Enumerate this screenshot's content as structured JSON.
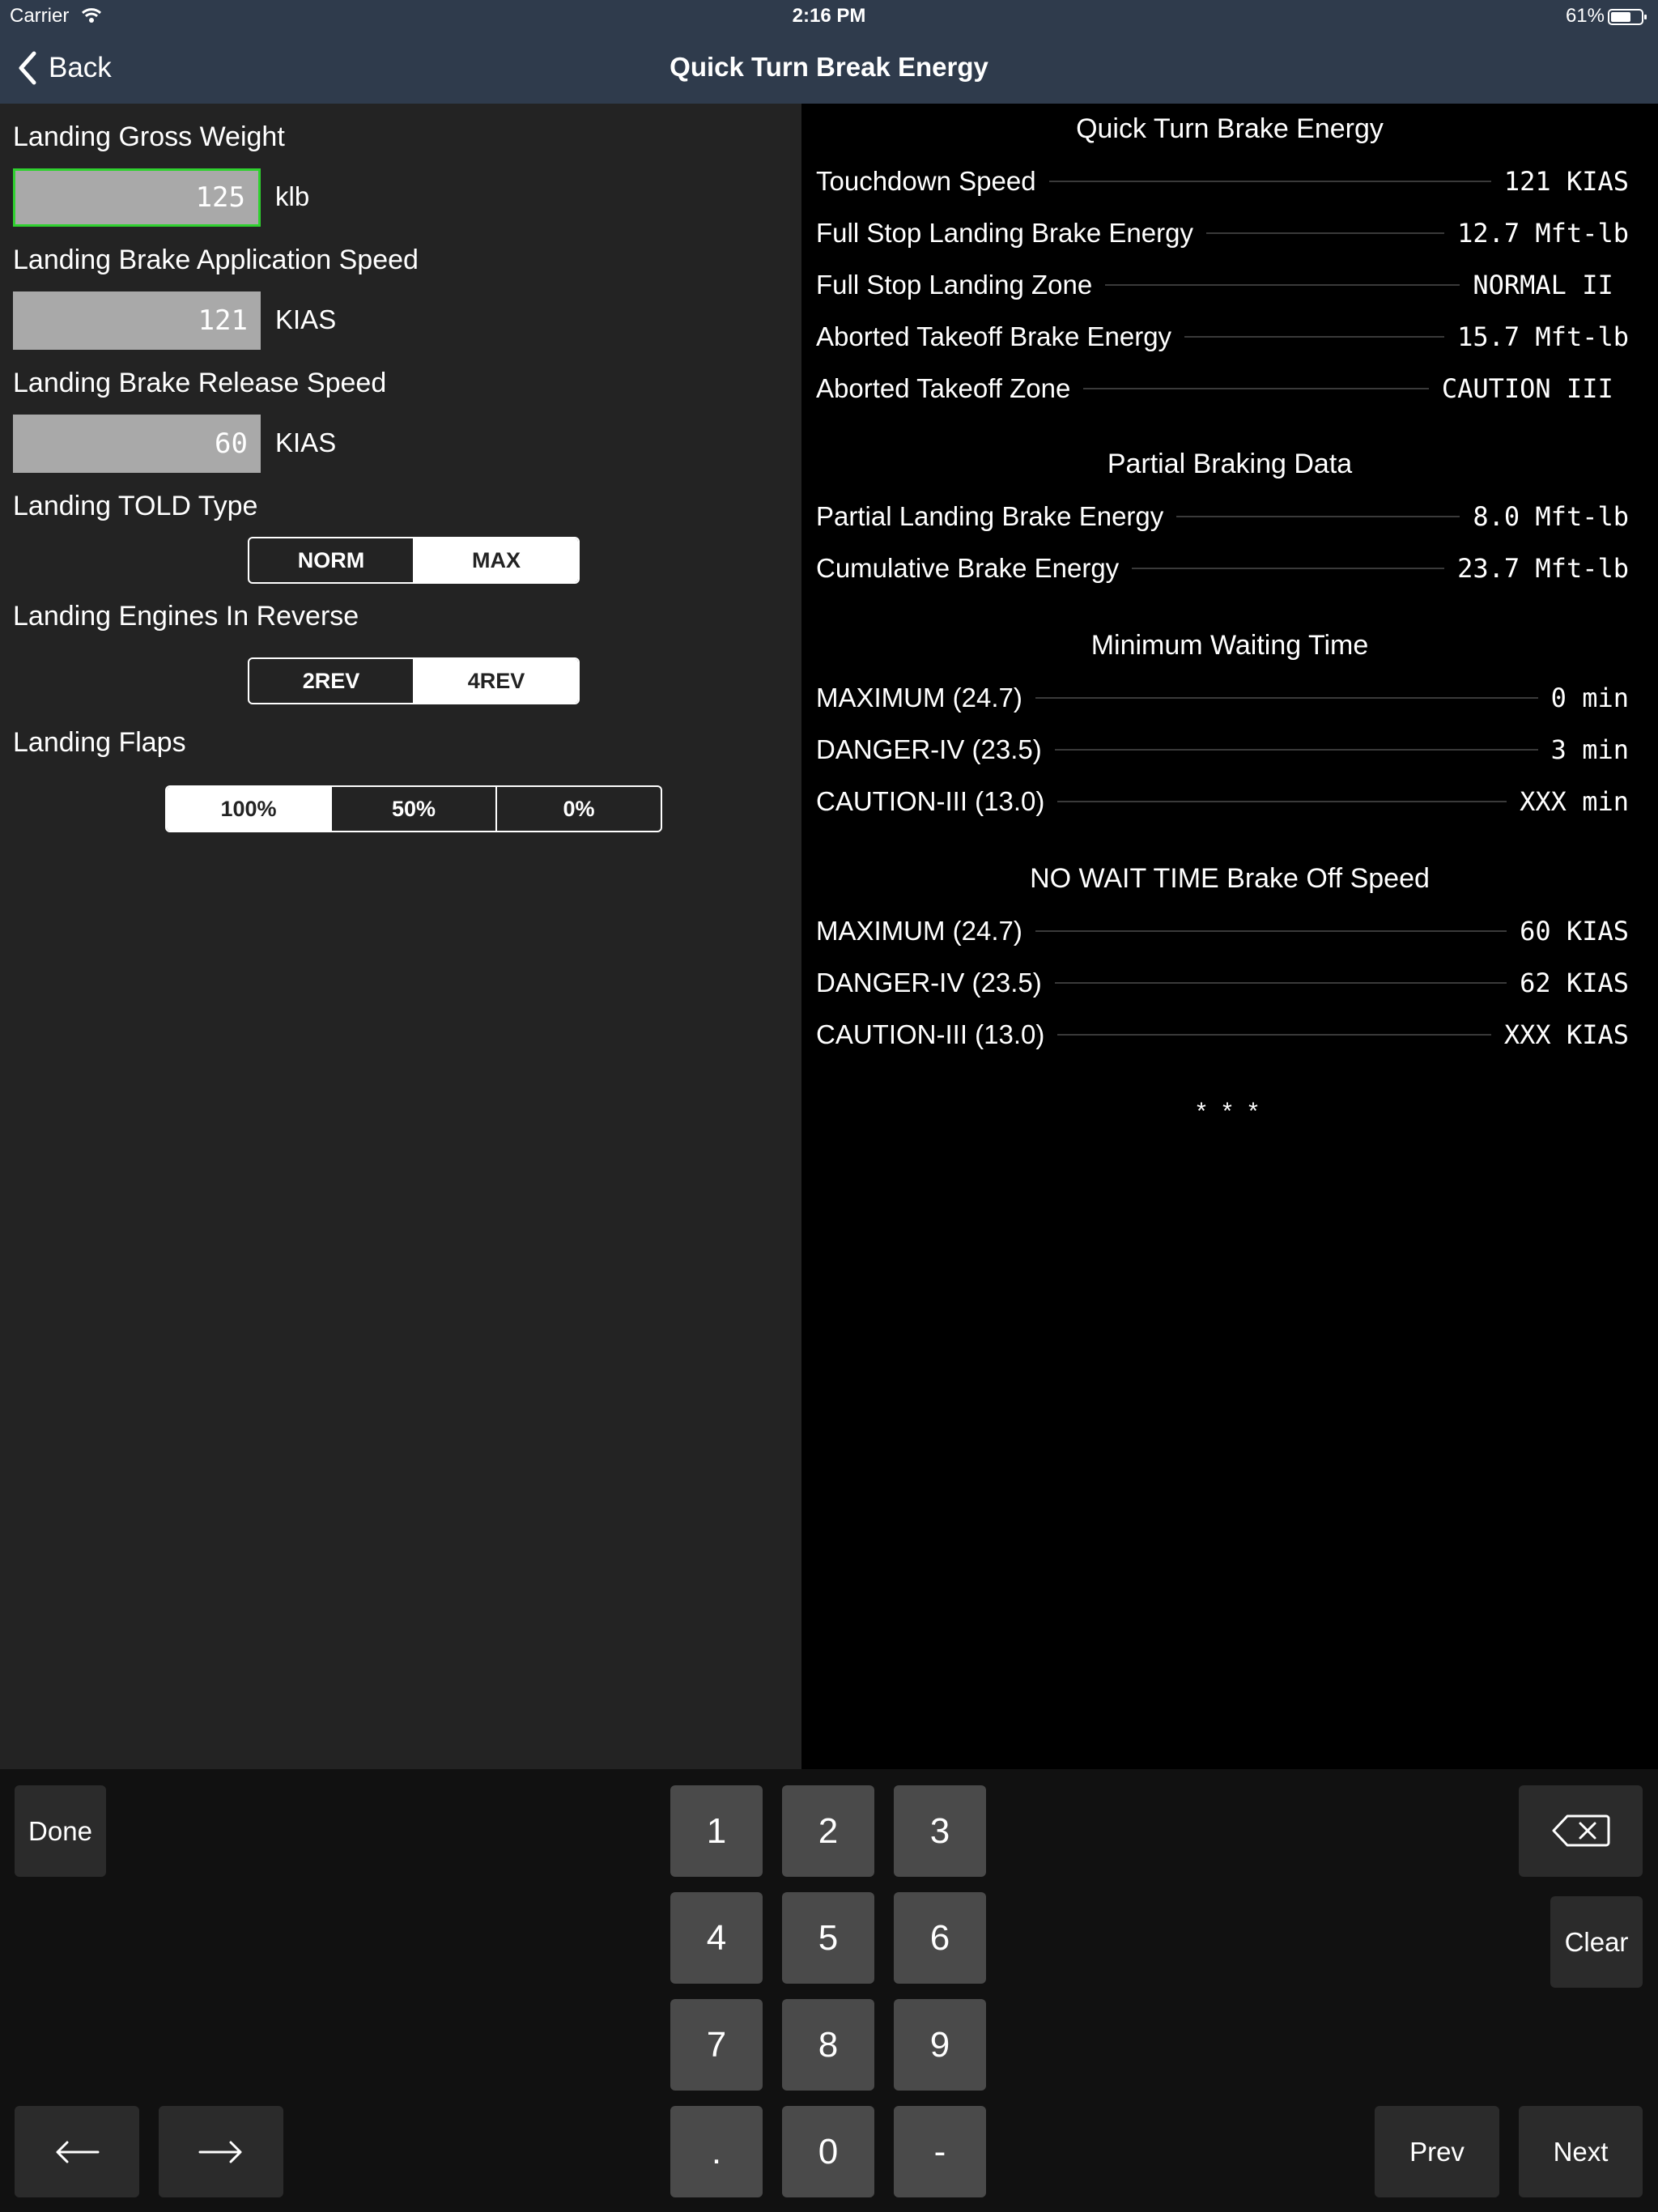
{
  "status": {
    "carrier": "Carrier",
    "time": "2:16 PM",
    "battery": "61%"
  },
  "nav": {
    "back_label": "Back",
    "title": "Quick Turn Break Energy"
  },
  "form": {
    "gross_weight": {
      "label": "Landing Gross Weight",
      "value": "125",
      "unit": "klb"
    },
    "application_speed": {
      "label": "Landing Brake Application Speed",
      "value": "121",
      "unit": "KIAS"
    },
    "release_speed": {
      "label": "Landing Brake Release Speed",
      "value": "60",
      "unit": "KIAS"
    },
    "told_type": {
      "label": "Landing TOLD Type",
      "options": [
        "NORM",
        "MAX"
      ],
      "selected": "MAX"
    },
    "reverse": {
      "label": "Landing Engines In Reverse",
      "options": [
        "2REV",
        "4REV"
      ],
      "selected": "4REV"
    },
    "flaps": {
      "label": "Landing Flaps",
      "options": [
        "100%",
        "50%",
        "0%"
      ],
      "selected": "100%"
    }
  },
  "results": {
    "energy": {
      "title": "Quick Turn Brake Energy",
      "rows": [
        {
          "label": "Touchdown Speed",
          "value": "121 KIAS"
        },
        {
          "label": "Full Stop Landing Brake Energy",
          "value": "12.7 Mft-lb"
        },
        {
          "label": "Full Stop Landing Zone",
          "value": "NORMAL II "
        },
        {
          "label": "Aborted Takeoff Brake Energy",
          "value": "15.7 Mft-lb"
        },
        {
          "label": "Aborted Takeoff Zone",
          "value": "CAUTION III "
        }
      ]
    },
    "partial": {
      "title": "Partial Braking Data",
      "rows": [
        {
          "label": "Partial Landing Brake Energy",
          "value": "8.0 Mft-lb"
        },
        {
          "label": "Cumulative Brake Energy",
          "value": "23.7 Mft-lb"
        }
      ]
    },
    "wait": {
      "title": "Minimum Waiting Time",
      "rows": [
        {
          "label": "MAXIMUM (24.7)",
          "value": "0 min"
        },
        {
          "label": "DANGER-IV (23.5)",
          "value": "3 min"
        },
        {
          "label": "CAUTION-III (13.0)",
          "value": "XXX min"
        }
      ]
    },
    "nowait": {
      "title": "NO WAIT TIME Brake Off Speed",
      "rows": [
        {
          "label": "MAXIMUM (24.7)",
          "value": "60 KIAS"
        },
        {
          "label": "DANGER-IV (23.5)",
          "value": "62 KIAS"
        },
        {
          "label": "CAUTION-III (13.0)",
          "value": "XXX KIAS"
        }
      ]
    },
    "footer": "* * *"
  },
  "keyboard": {
    "done": "Done",
    "clear": "Clear",
    "prev": "Prev",
    "next": "Next",
    "digits": [
      "1",
      "2",
      "3",
      "4",
      "5",
      "6",
      "7",
      "8",
      "9",
      ".",
      "0",
      "-"
    ]
  },
  "colors": {
    "nav_bg": "#2f3b4c",
    "panel_bg": "#232323",
    "active_field_border": "#2fd12f"
  }
}
